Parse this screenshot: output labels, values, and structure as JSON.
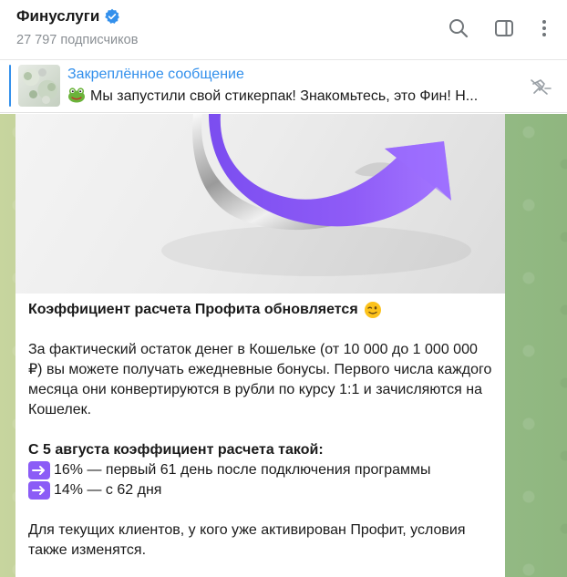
{
  "header": {
    "title": "Финуслуги",
    "subscribers": "27 797 подписчиков",
    "icons": [
      "verified-icon",
      "search-icon",
      "sidebar-toggle-icon",
      "more-vertical-icon"
    ]
  },
  "pinned": {
    "title": "Закреплённое сообщение",
    "text": "Мы запустили свой стикерпак!  Знакомьтесь, это Фин! Н...",
    "icons": [
      "frog-icon",
      "unpin-icon"
    ]
  },
  "message": {
    "headline": "Коэффициент расчета Профита обновляется",
    "paragraph1": "За фактический остаток денег в Кошельке (от 10 000 до 1 000 000 ₽) вы можете получать ежедневные бонусы. Первого числа каждого месяца они конвертируются в рубли по курсу 1:1 и зачисляются на Кошелек.",
    "rate_heading": "С 5 августа коэффициент расчета такой:",
    "rates": [
      "16% — первый 61 день после подключения программы",
      "14% — с 62 дня"
    ],
    "paragraph2": "Для текущих клиентов, у кого уже активирован Профит, условия также изменятся.",
    "icons": [
      "wink-emoji-icon",
      "right-arrow-icon"
    ]
  },
  "colors": {
    "accent": "#3390ec",
    "badge": "#8b5cf6",
    "chat_background": "#a7c690"
  }
}
